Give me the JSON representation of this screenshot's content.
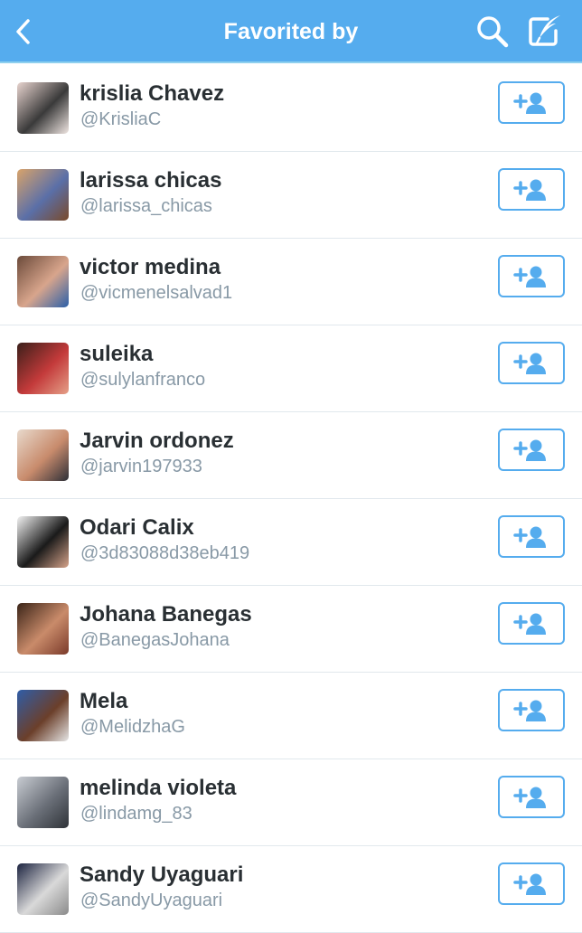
{
  "header": {
    "title": "Favorited by",
    "back_icon": "chevron-left-icon",
    "search_icon": "search-icon",
    "compose_icon": "compose-tweet-icon",
    "bar_color": "#55acee"
  },
  "users": [
    {
      "name": "krislia Chavez",
      "handle": "@KrisliaC",
      "avatar_colors": [
        "#e8d4cf",
        "#3a3a3a",
        "#f0e6e2"
      ]
    },
    {
      "name": "larissa chicas",
      "handle": "@larissa_chicas",
      "avatar_colors": [
        "#d9a36a",
        "#5a6fa8",
        "#7a4a2a"
      ]
    },
    {
      "name": "victor medina",
      "handle": "@vicmenelsalvad1",
      "avatar_colors": [
        "#6b4a3a",
        "#d8a58c",
        "#2b5fa8"
      ]
    },
    {
      "name": "suleika",
      "handle": "@sulylanfranco",
      "avatar_colors": [
        "#3a1f1a",
        "#c33a3a",
        "#e5a088"
      ]
    },
    {
      "name": "Jarvin ordonez",
      "handle": "@jarvin197933",
      "avatar_colors": [
        "#e8d9cc",
        "#c88b6c",
        "#2d2f38"
      ]
    },
    {
      "name": "Odari Calix",
      "handle": "@3d83088d38eb419",
      "avatar_colors": [
        "#f2f2f2",
        "#1a1a1a",
        "#d6a38a"
      ]
    },
    {
      "name": "Johana Banegas",
      "handle": "@BanegasJohana",
      "avatar_colors": [
        "#3a2418",
        "#c98b6a",
        "#7a3a2a"
      ]
    },
    {
      "name": "Mela",
      "handle": "@MelidzhaG",
      "avatar_colors": [
        "#2f5da8",
        "#6b3f2a",
        "#e6e6e6"
      ]
    },
    {
      "name": "melinda violeta",
      "handle": "@lindamg_83",
      "avatar_colors": [
        "#c8ccd2",
        "#6a6f78",
        "#2f3338"
      ]
    },
    {
      "name": "Sandy Uyaguari",
      "handle": "@SandyUyaguari",
      "avatar_colors": [
        "#1c2340",
        "#d9d9d9",
        "#8a8a8a"
      ]
    }
  ],
  "follow_icon": "add-user-icon",
  "accent_color": "#55acee"
}
